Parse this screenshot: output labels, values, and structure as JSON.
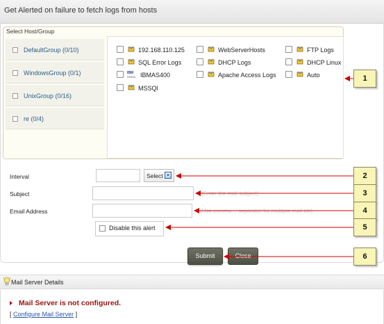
{
  "header": {
    "title": "Get Alerted on failure to fetch logs from hosts"
  },
  "host_group": {
    "title": "Select Host/Group",
    "groups": [
      {
        "label": "DefaultGroup (0/10)"
      },
      {
        "label": "WindowsGroup (0/1)"
      },
      {
        "label": "UnixGroup (0/16)"
      },
      {
        "label": "re (0/4)"
      }
    ],
    "hosts": [
      {
        "label": "192.168.110.125",
        "icon": "host-icon"
      },
      {
        "label": "WebServerHosts",
        "icon": "host-icon"
      },
      {
        "label": "FTP Logs",
        "icon": "host-icon"
      },
      {
        "label": "SQL Error Logs",
        "icon": "host-icon"
      },
      {
        "label": "DHCP Logs",
        "icon": "host-icon"
      },
      {
        "label": "DHCP Linux",
        "icon": "host-icon"
      },
      {
        "label": "IBMAS400",
        "icon": "ibm-as400-icon"
      },
      {
        "label": "Apache Access Logs",
        "icon": "host-icon"
      },
      {
        "label": "Auto",
        "icon": "host-icon"
      },
      {
        "label": "MSSQl",
        "icon": "host-icon"
      }
    ]
  },
  "form": {
    "interval_label": "Interval",
    "interval_select": "Select",
    "subject_label": "Subject",
    "subject_hint": "(Enter the mail subject)",
    "email_label": "Email Address",
    "email_hint": "(Use comma ',' separator for multiple mail ids)",
    "disable_label": "Disable this alert"
  },
  "buttons": {
    "submit": "Submit",
    "close": "Close"
  },
  "callouts": [
    "1",
    "2",
    "3",
    "4",
    "5",
    "6"
  ],
  "mail_server": {
    "title": "Mail Server Details",
    "error": "Mail Server is not configured.",
    "link_open": "[",
    "link": "Configure Mail Server",
    "link_close": "]"
  },
  "colors": {
    "callout_fill": "#f8f5b6",
    "arrow": "#cc0000",
    "error": "#9a1111",
    "link": "#2a55a8"
  }
}
